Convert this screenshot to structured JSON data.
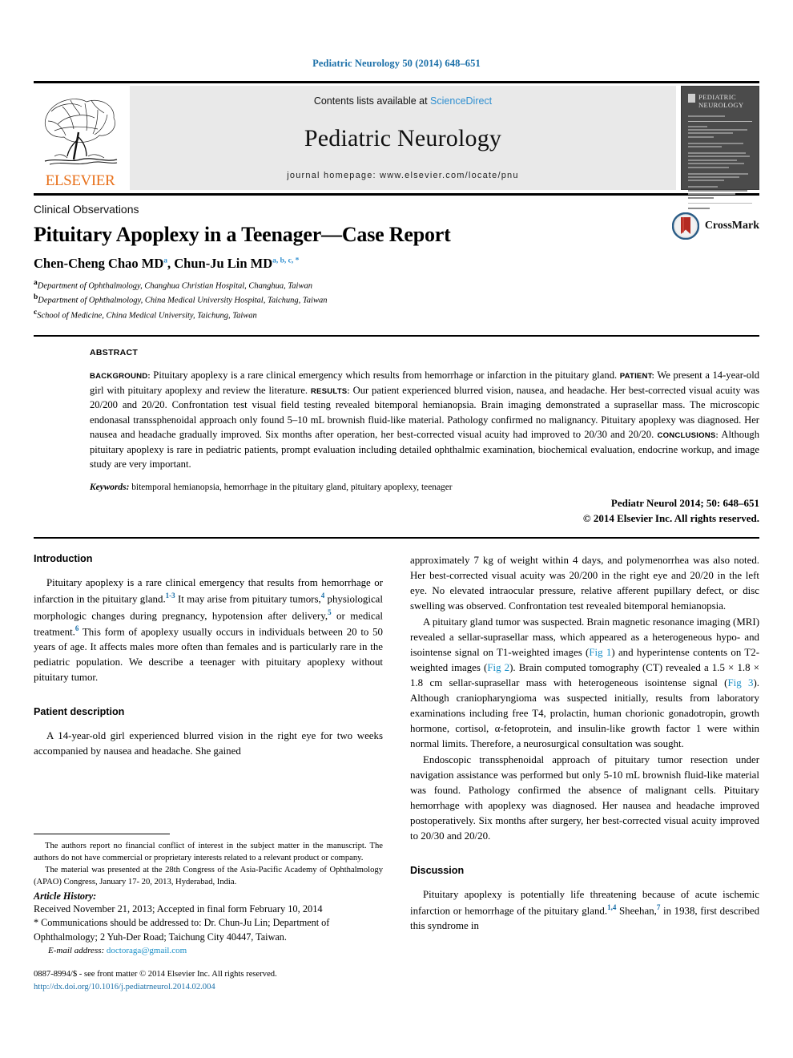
{
  "running_head": "Pediatric Neurology 50 (2014) 648–651",
  "banner": {
    "publisher_name": "ELSEVIER",
    "contents_prefix": "Contents lists available at ",
    "sciencedirect": "ScienceDirect",
    "journal_title": "Pediatric Neurology",
    "homepage": "journal homepage: www.elsevier.com/locate/pnu",
    "cover_title": "PEDIATRIC NEUROLOGY"
  },
  "title_block": {
    "kicker": "Clinical Observations",
    "title": "Pituitary Apoplexy in a Teenager—Case Report",
    "author1_name": "Chen-Cheng Chao MD",
    "author1_sup": "a",
    "author_sep": ", ",
    "author2_name": "Chun-Ju Lin MD",
    "author2_sup": "a, b, c, *",
    "affiliations": [
      {
        "marker": "a",
        "text": "Department of Ophthalmology, Changhua Christian Hospital, Changhua, Taiwan"
      },
      {
        "marker": "b",
        "text": "Department of Ophthalmology, China Medical University Hospital, Taichung, Taiwan"
      },
      {
        "marker": "c",
        "text": "School of Medicine, China Medical University, Taichung, Taiwan"
      }
    ],
    "crossmark_label": "CrossMark"
  },
  "abstract": {
    "label": "ABSTRACT",
    "background_label": "BACKGROUND:",
    "background_text": " Pituitary apoplexy is a rare clinical emergency which results from hemorrhage or infarction in the pituitary gland. ",
    "patient_label": "PATIENT:",
    "patient_text": " We present a 14-year-old girl with pituitary apoplexy and review the literature. ",
    "results_label": "RESULTS:",
    "results_text": " Our patient experienced blurred vision, nausea, and headache. Her best-corrected visual acuity was 20/200 and 20/20. Confrontation test visual field testing revealed bitemporal hemianopsia. Brain imaging demonstrated a suprasellar mass. The microscopic endonasal transsphenoidal approach only found 5–10 mL brownish fluid-like material. Pathology confirmed no malignancy. Pituitary apoplexy was diagnosed. Her nausea and headache gradually improved. Six months after operation, her best-corrected visual acuity had improved to 20/30 and 20/20. ",
    "conclusions_label": "CONCLUSIONS:",
    "conclusions_text": " Although pituitary apoplexy is rare in pediatric patients, prompt evaluation including detailed ophthalmic examination, biochemical evaluation, endocrine workup, and image study are very important.",
    "keywords_label": "Keywords:",
    "keywords_text": " bitemporal hemianopsia, hemorrhage in the pituitary gland, pituitary apoplexy, teenager",
    "citation_line": "Pediatr Neurol 2014; 50: 648–651",
    "copyright_line": "© 2014 Elsevier Inc. All rights reserved."
  },
  "left_column": {
    "intro_heading": "Introduction",
    "intro_p1_a": "Pituitary apoplexy is a rare clinical emergency that results from hemorrhage or infarction in the pituitary gland.",
    "intro_ref1": "1-3",
    "intro_p1_b": " It may arise from pituitary tumors,",
    "intro_ref2": "4",
    "intro_p1_c": " physiological morphologic changes during pregnancy, hypotension after delivery,",
    "intro_ref3": "5",
    "intro_p1_d": " or medical treatment.",
    "intro_ref4": "6",
    "intro_p1_e": " This form of apoplexy usually occurs in individuals between 20 to 50 years of age. It affects males more often than females and is particularly rare in the pediatric population. We describe a teenager with pituitary apoplexy without pituitary tumor.",
    "patient_heading": "Patient description",
    "patient_p1": "A 14-year-old girl experienced blurred vision in the right eye for two weeks accompanied by nausea and headache. She gained"
  },
  "right_column": {
    "cont_p1": "approximately 7 kg of weight within 4 days, and polymenorrhea was also noted. Her best-corrected visual acuity was 20/200 in the right eye and 20/20 in the left eye. No elevated intraocular pressure, relative afferent pupillary defect, or disc swelling was observed. Confrontation test revealed bitemporal hemianopsia.",
    "p2_a": "A pituitary gland tumor was suspected. Brain magnetic resonance imaging (MRI) revealed a sellar-suprasellar mass, which appeared as a heterogeneous hypo- and isointense signal on T1-weighted images (",
    "fig1": "Fig 1",
    "p2_b": ") and hyperintense contents on T2-weighted images (",
    "fig2": "Fig 2",
    "p2_c": "). Brain computed tomography (CT) revealed a 1.5 × 1.8 × 1.8 cm sellar-suprasellar mass with heterogeneous isointense signal (",
    "fig3": "Fig 3",
    "p2_d": "). Although craniopharyngioma was suspected initially, results from laboratory examinations including free T4, prolactin, human chorionic gonadotropin, growth hormone, cortisol, α-fetoprotein, and insulin-like growth factor 1 were within normal limits. Therefore, a neurosurgical consultation was sought.",
    "p3": "Endoscopic transsphenoidal approach of pituitary tumor resection under navigation assistance was performed but only 5-10 mL brownish fluid-like material was found. Pathology confirmed the absence of malignant cells. Pituitary hemorrhage with apoplexy was diagnosed. Her nausea and headache improved postoperatively. Six months after surgery, her best-corrected visual acuity improved to 20/30 and 20/20.",
    "discussion_heading": "Discussion",
    "disc_p1_a": "Pituitary apoplexy is potentially life threatening because of acute ischemic infarction or hemorrhage of the pituitary gland.",
    "disc_ref1": "1,4",
    "disc_p1_b": " Sheehan,",
    "disc_ref2": "7",
    "disc_p1_c": " in 1938, first described this syndrome in"
  },
  "footnotes": {
    "conflict": "The authors report no financial conflict of interest in the subject matter in the manuscript. The authors do not have commercial or proprietary interests related to a relevant product or company.",
    "presented": "The material was presented at the 28th Congress of the Asia-Pacific Academy of Ophthalmology (APAO) Congress, January 17- 20, 2013, Hyderabad, India.",
    "history_label": "Article History:",
    "received": "Received November 21, 2013; Accepted in final form February 10, 2014",
    "correspondence": "* Communications should be addressed to: Dr. Chun-Ju Lin; Department of Ophthalmology; 2 Yuh-Der Road; Taichung City 40447, Taiwan.",
    "email_label": "E-mail address:",
    "email": "doctoraga@gmail.com",
    "issn_line": "0887-8994/$ - see front matter © 2014 Elsevier Inc. All rights reserved.",
    "doi": "http://dx.doi.org/10.1016/j.pediatrneurol.2014.02.004"
  },
  "colors": {
    "link": "#1a8fc7",
    "running_head": "#1a6fa8",
    "elsevier_orange": "#e8701a",
    "banner_bg": "#e9e9e9",
    "cover_bg": "#4b4b4b"
  }
}
